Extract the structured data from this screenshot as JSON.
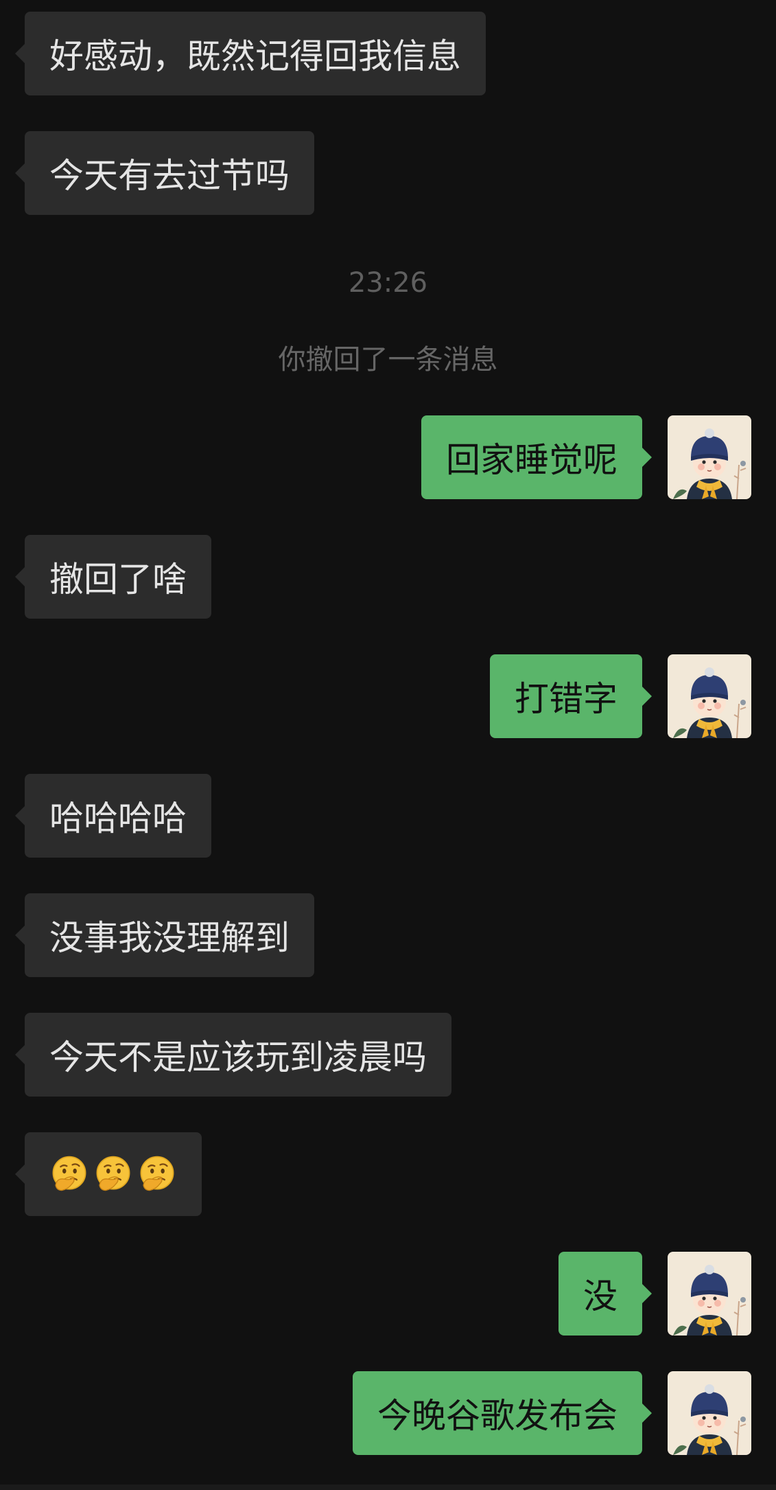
{
  "colors": {
    "background": "#111111",
    "incoming_bubble": "#2c2c2c",
    "outgoing_bubble": "#5ab56a",
    "system_text": "#5f5f5f"
  },
  "messages": [
    {
      "text": "好感动，既然记得回我信息"
    },
    {
      "text": "今天有去过节吗"
    },
    {
      "timestamp": "23:26"
    },
    {
      "notice": "你撤回了一条消息"
    },
    {
      "text": "回家睡觉呢",
      "avatar_icon": "cartoon-boy-avatar-icon"
    },
    {
      "text": "撤回了啥"
    },
    {
      "text": "打错字",
      "avatar_icon": "cartoon-boy-avatar-icon"
    },
    {
      "text": "哈哈哈哈"
    },
    {
      "text": "没事我没理解到"
    },
    {
      "text": "今天不是应该玩到凌晨吗"
    },
    {
      "emoji": [
        "thinking-face-icon",
        "thinking-face-icon",
        "thinking-face-icon"
      ]
    },
    {
      "text": "没",
      "avatar_icon": "cartoon-boy-avatar-icon"
    },
    {
      "text": "今晚谷歌发布会",
      "avatar_icon": "cartoon-boy-avatar-icon"
    }
  ]
}
